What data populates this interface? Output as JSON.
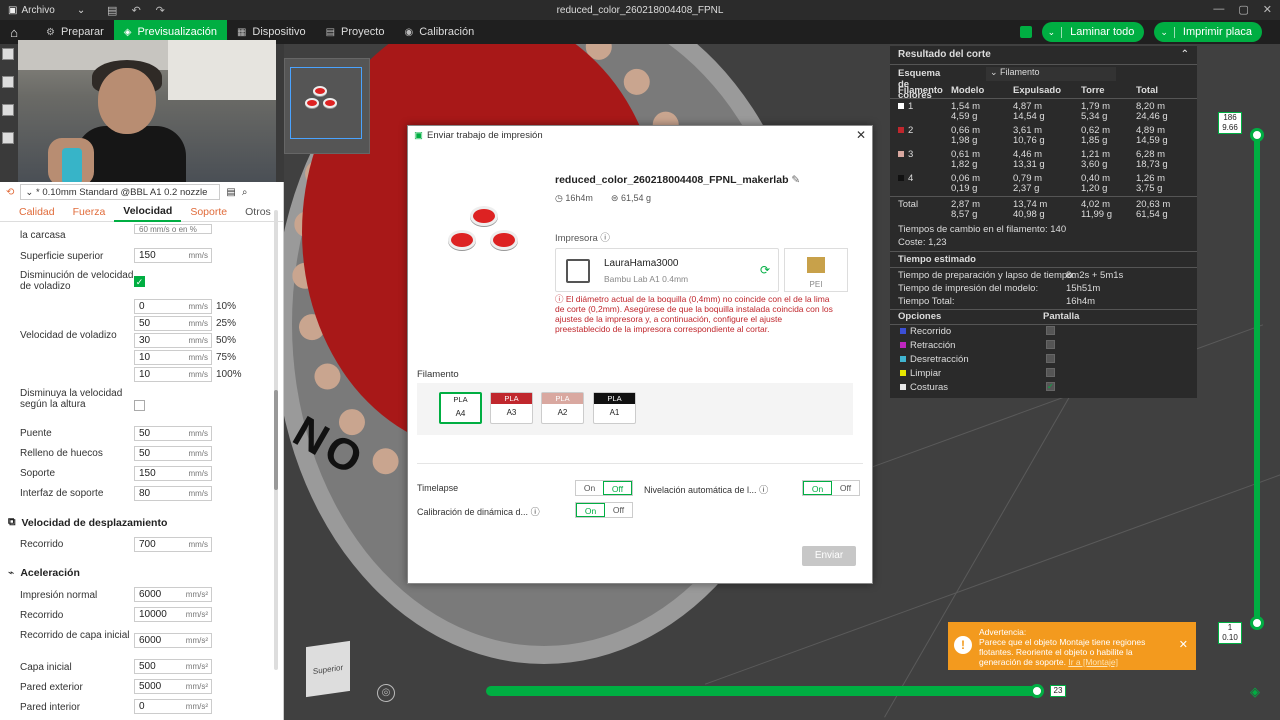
{
  "titlebar": {
    "menu_label": "Archivo",
    "title": "reduced_color_260218004408_FPNL"
  },
  "nav": {
    "tabs": [
      {
        "label": "Preparar",
        "icon": "gear-icon"
      },
      {
        "label": "Previsualización",
        "icon": "preview-icon"
      },
      {
        "label": "Dispositivo",
        "icon": "device-icon"
      },
      {
        "label": "Proyecto",
        "icon": "project-icon"
      },
      {
        "label": "Calibración",
        "icon": "calibration-icon"
      }
    ],
    "slice_all": "Laminar todo",
    "print_plate": "Imprimir placa"
  },
  "sidebar": {
    "preset": "* 0.10mm Standard @BBL A1 0.2 nozzle",
    "subtabs": [
      "Calidad",
      "Fuerza",
      "Velocidad",
      "Soporte",
      "Otros"
    ],
    "rows": {
      "carcasa": "la carcasa",
      "carcasa_val": "60 mm/s o en %",
      "sup_sup": "Superficie superior",
      "sup_sup_val": "150",
      "dism": "Disminución de velocidad de voladizo",
      "vel_vol": "Velocidad de voladizo",
      "vol_vals": [
        "0",
        "50",
        "30",
        "10",
        "10"
      ],
      "vol_pcts": [
        "10%",
        "25%",
        "50%",
        "75%",
        "100%"
      ],
      "dism_alt": "Disminuya la velocidad según la altura",
      "puente": "Puente",
      "puente_val": "50",
      "relleno": "Relleno de huecos",
      "relleno_val": "50",
      "soporte": "Soporte",
      "soporte_val": "150",
      "interfaz": "Interfaz de soporte",
      "interfaz_val": "80",
      "sec_desp": "Velocidad de desplazamiento",
      "recorrido": "Recorrido",
      "recorrido_val": "700",
      "sec_acel": "Aceleración",
      "imp_normal": "Impresión normal",
      "imp_normal_val": "6000",
      "recorrido2": "Recorrido",
      "recorrido2_val": "10000",
      "rec_capa": "Recorrido de capa inicial",
      "rec_capa_val": "6000",
      "capa_ini": "Capa inicial",
      "capa_ini_val": "500",
      "pared_ext": "Pared exterior",
      "pared_ext_val": "5000",
      "pared_int": "Pared interior",
      "pared_int_val": "0"
    },
    "unit_speed": "mm/s",
    "unit_acc": "mm/s²"
  },
  "result": {
    "title": "Resultado del corte",
    "scheme_label": "Esquema de colores",
    "scheme_value": "Filamento",
    "headers": [
      "Filamento",
      "Modelo",
      "Expulsado",
      "Torre",
      "Total"
    ],
    "rows": [
      {
        "id": "1",
        "color": "#ffffff",
        "modelo": [
          "1,54 m",
          "4,59 g"
        ],
        "exp": [
          "4,87 m",
          "14,54 g"
        ],
        "torre": [
          "1,79 m",
          "5,34 g"
        ],
        "total": [
          "8,20 m",
          "24,46 g"
        ]
      },
      {
        "id": "2",
        "color": "#c0272d",
        "modelo": [
          "0,66 m",
          "1,98 g"
        ],
        "exp": [
          "3,61 m",
          "10,76 g"
        ],
        "torre": [
          "0,62 m",
          "1,85 g"
        ],
        "total": [
          "4,89 m",
          "14,59 g"
        ]
      },
      {
        "id": "3",
        "color": "#d9a8a0",
        "modelo": [
          "0,61 m",
          "1,82 g"
        ],
        "exp": [
          "4,46 m",
          "13,31 g"
        ],
        "torre": [
          "1,21 m",
          "3,60 g"
        ],
        "total": [
          "6,28 m",
          "18,73 g"
        ]
      },
      {
        "id": "4",
        "color": "#111111",
        "modelo": [
          "0,06 m",
          "0,19 g"
        ],
        "exp": [
          "0,79 m",
          "2,37 g"
        ],
        "torre": [
          "0,40 m",
          "1,20 g"
        ],
        "total": [
          "1,26 m",
          "3,75 g"
        ]
      }
    ],
    "total_row": {
      "label": "Total",
      "modelo": [
        "2,87 m",
        "8,57 g"
      ],
      "exp": [
        "13,74 m",
        "40,98 g"
      ],
      "torre": [
        "4,02 m",
        "11,99 g"
      ],
      "total": [
        "20,63 m",
        "61,54 g"
      ]
    },
    "changes": "Tiempos de cambio en el filamento:  140",
    "cost": "Coste:  1,23",
    "est_title": "Tiempo estimado",
    "prep": "Tiempo de preparación y lapso de tiempo:",
    "prep_val": "8m2s + 5m1s",
    "model_time": "Tiempo de impresión del modelo:",
    "model_time_val": "15h51m",
    "total_time": "Tiempo Total:",
    "total_time_val": "16h4m",
    "options_label": "Opciones",
    "display_label": "Pantalla",
    "options": [
      {
        "name": "Recorrido",
        "color": "#3b4fd6"
      },
      {
        "name": "Retracción",
        "color": "#c026c0"
      },
      {
        "name": "Desretracción",
        "color": "#40b4d0"
      },
      {
        "name": "Limpiar",
        "color": "#e6e600"
      },
      {
        "name": "Costuras",
        "color": "#e8e8e8"
      }
    ]
  },
  "dialog": {
    "title": "Enviar trabajo de impresión",
    "file": "reduced_color_260218004408_FPNL_makerlab",
    "time": "16h4m",
    "weight": "61,54 g",
    "printer_label": "Impresora",
    "printer_name": "LauraHama3000",
    "printer_model": "Bambu Lab A1  0.4mm",
    "plate": "PEI",
    "warning": "El diámetro actual de la boquilla (0,4mm) no coincide con el de la lima de corte (0,2mm). Asegúrese de que la boquilla instalada coincida con los ajustes de la impresora y, a continuación, configure el ajuste preestablecido de la impresora correspondiente al cortar.",
    "filament_label": "Filamento",
    "filaments": [
      {
        "type": "PLA",
        "slot": "A4",
        "color": "#ffffff",
        "text": "#222222"
      },
      {
        "type": "PLA",
        "slot": "A3",
        "color": "#c0272d",
        "text": "#ffffff"
      },
      {
        "type": "PLA",
        "slot": "A2",
        "color": "#d9a8a0",
        "text": "#ffffff"
      },
      {
        "type": "PLA",
        "slot": "A1",
        "color": "#111111",
        "text": "#ffffff"
      }
    ],
    "timelapse": "Timelapse",
    "leveling": "Nivelación automática de l...",
    "calib": "Calibración de dinámica d...",
    "on": "On",
    "off": "Off",
    "send": "Enviar"
  },
  "slider": {
    "top_a": "186",
    "top_b": "9.66",
    "bottom_a": "1",
    "bottom_b": "0.10",
    "h_value": "23",
    "progress": 0.95
  },
  "toast": {
    "title": "Advertencia:",
    "body": "Parece que el objeto Montaje tiene regiones flotantes. Reoriente el objeto o habilite la generación de soporte.",
    "link": "Ir a [Montaje]"
  },
  "viewport": {
    "cube_label": "Superior"
  }
}
